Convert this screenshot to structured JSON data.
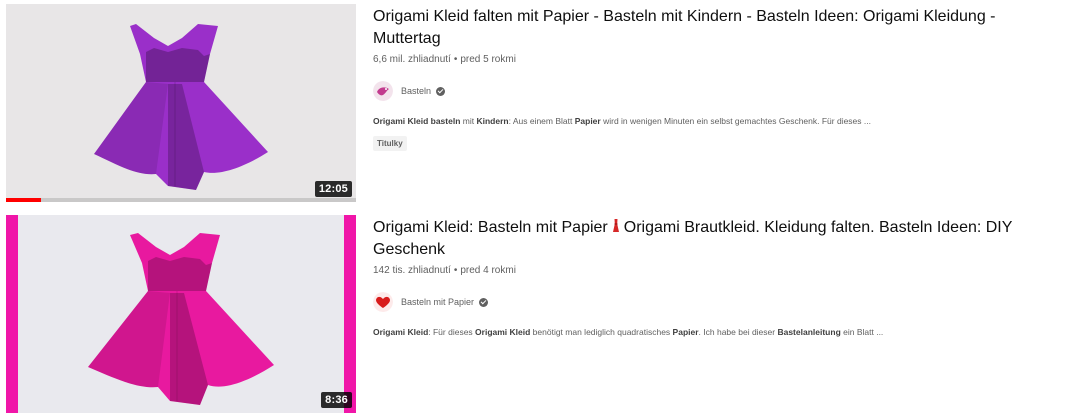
{
  "results": [
    {
      "title": "Origami Kleid falten mit Papier - Basteln mit Kindern - Basteln Ideen: Origami Kleidung - Muttertag",
      "views": "6,6 mil. zhliadnutí",
      "age": "pred 5 rokmi",
      "channel": "Basteln",
      "snippet_parts": [
        {
          "b": true,
          "t": "Origami Kleid basteln"
        },
        {
          "b": false,
          "t": " mit "
        },
        {
          "b": true,
          "t": "Kindern"
        },
        {
          "b": false,
          "t": ": Aus einem Blatt "
        },
        {
          "b": true,
          "t": "Papier"
        },
        {
          "b": false,
          "t": " wird in wenigen Minuten ein selbst gemachtes Geschenk. Für dieses ..."
        }
      ],
      "badge": "Titulky",
      "duration": "12:05",
      "watch_progress": 0.1,
      "dress_color": "#9a2fc9",
      "bg_color": "#e8e6e7",
      "avatar_color": "#c23b8e"
    },
    {
      "title_before": "Origami Kleid: Basteln mit Papier",
      "title_icon": "dress-emoji-icon",
      "title_after": "Origami Brautkleid. Kleidung falten. Basteln Ideen: DIY Geschenk",
      "views": "142 tis. zhliadnutí",
      "age": "pred 4 rokmi",
      "channel": "Basteln mit Papier",
      "snippet_parts": [
        {
          "b": true,
          "t": "Origami Kleid"
        },
        {
          "b": false,
          "t": ": Für dieses "
        },
        {
          "b": true,
          "t": "Origami Kleid"
        },
        {
          "b": false,
          "t": " benötigt man lediglich quadratisches "
        },
        {
          "b": true,
          "t": "Papier"
        },
        {
          "b": false,
          "t": ". Ich habe bei dieser "
        },
        {
          "b": true,
          "t": "Bastelanleitung"
        },
        {
          "b": false,
          "t": " ein Blatt ..."
        }
      ],
      "duration": "8:36",
      "dress_color": "#e8199f",
      "bg_color": "#e9e9ee",
      "border_color": "#f016a8",
      "avatar_color": "#d81b1b"
    }
  ],
  "separator_dot": "•"
}
